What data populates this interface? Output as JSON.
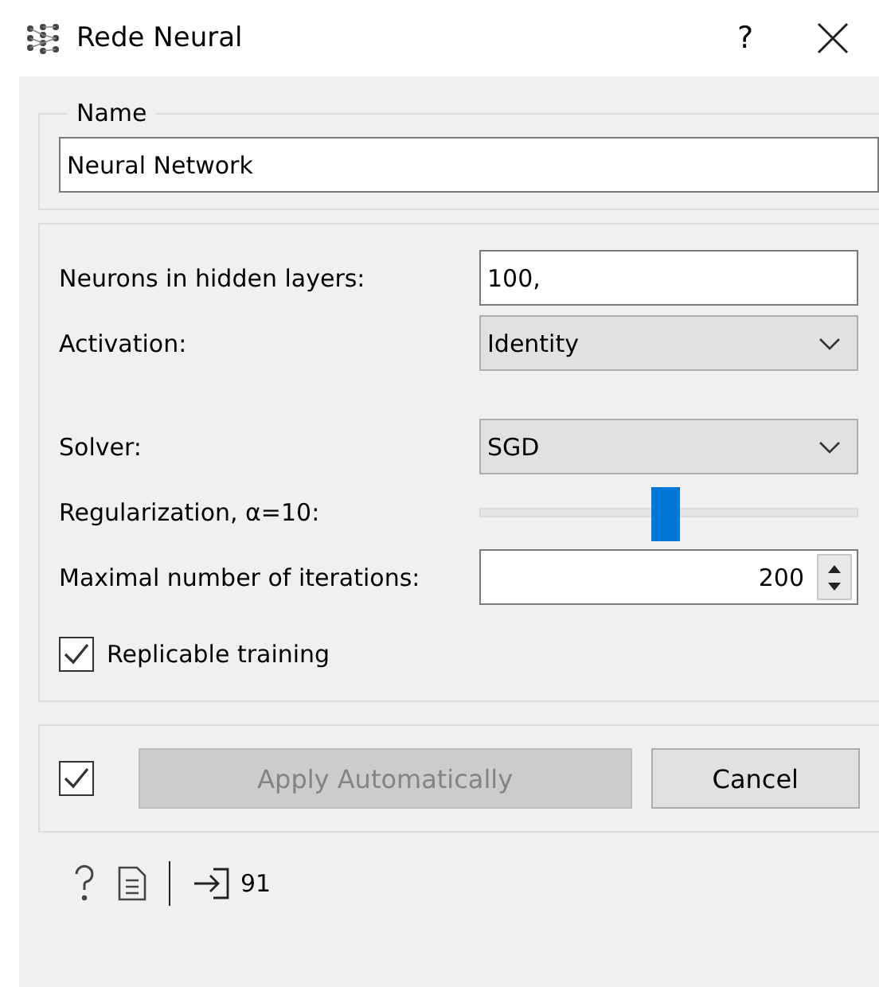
{
  "window": {
    "title": "Rede Neural",
    "help_button": "?"
  },
  "name_group": {
    "title": "Name",
    "value": "Neural Network"
  },
  "params": {
    "neurons": {
      "label": "Neurons in hidden layers:",
      "value": "100,"
    },
    "activation": {
      "label": "Activation:",
      "value": "Identity"
    },
    "solver": {
      "label": "Solver:",
      "value": "SGD"
    },
    "regularization": {
      "label": "Regularization, α=10:",
      "level": 0.49
    },
    "iterations": {
      "label": "Maximal number of iterations:",
      "value": "200"
    },
    "replicable": {
      "label": "Replicable training",
      "checked": true
    }
  },
  "apply": {
    "auto_checked": true,
    "apply_label": "Apply Automatically",
    "apply_disabled": true,
    "cancel_label": "Cancel"
  },
  "status_bar": {
    "input_count": "91"
  }
}
